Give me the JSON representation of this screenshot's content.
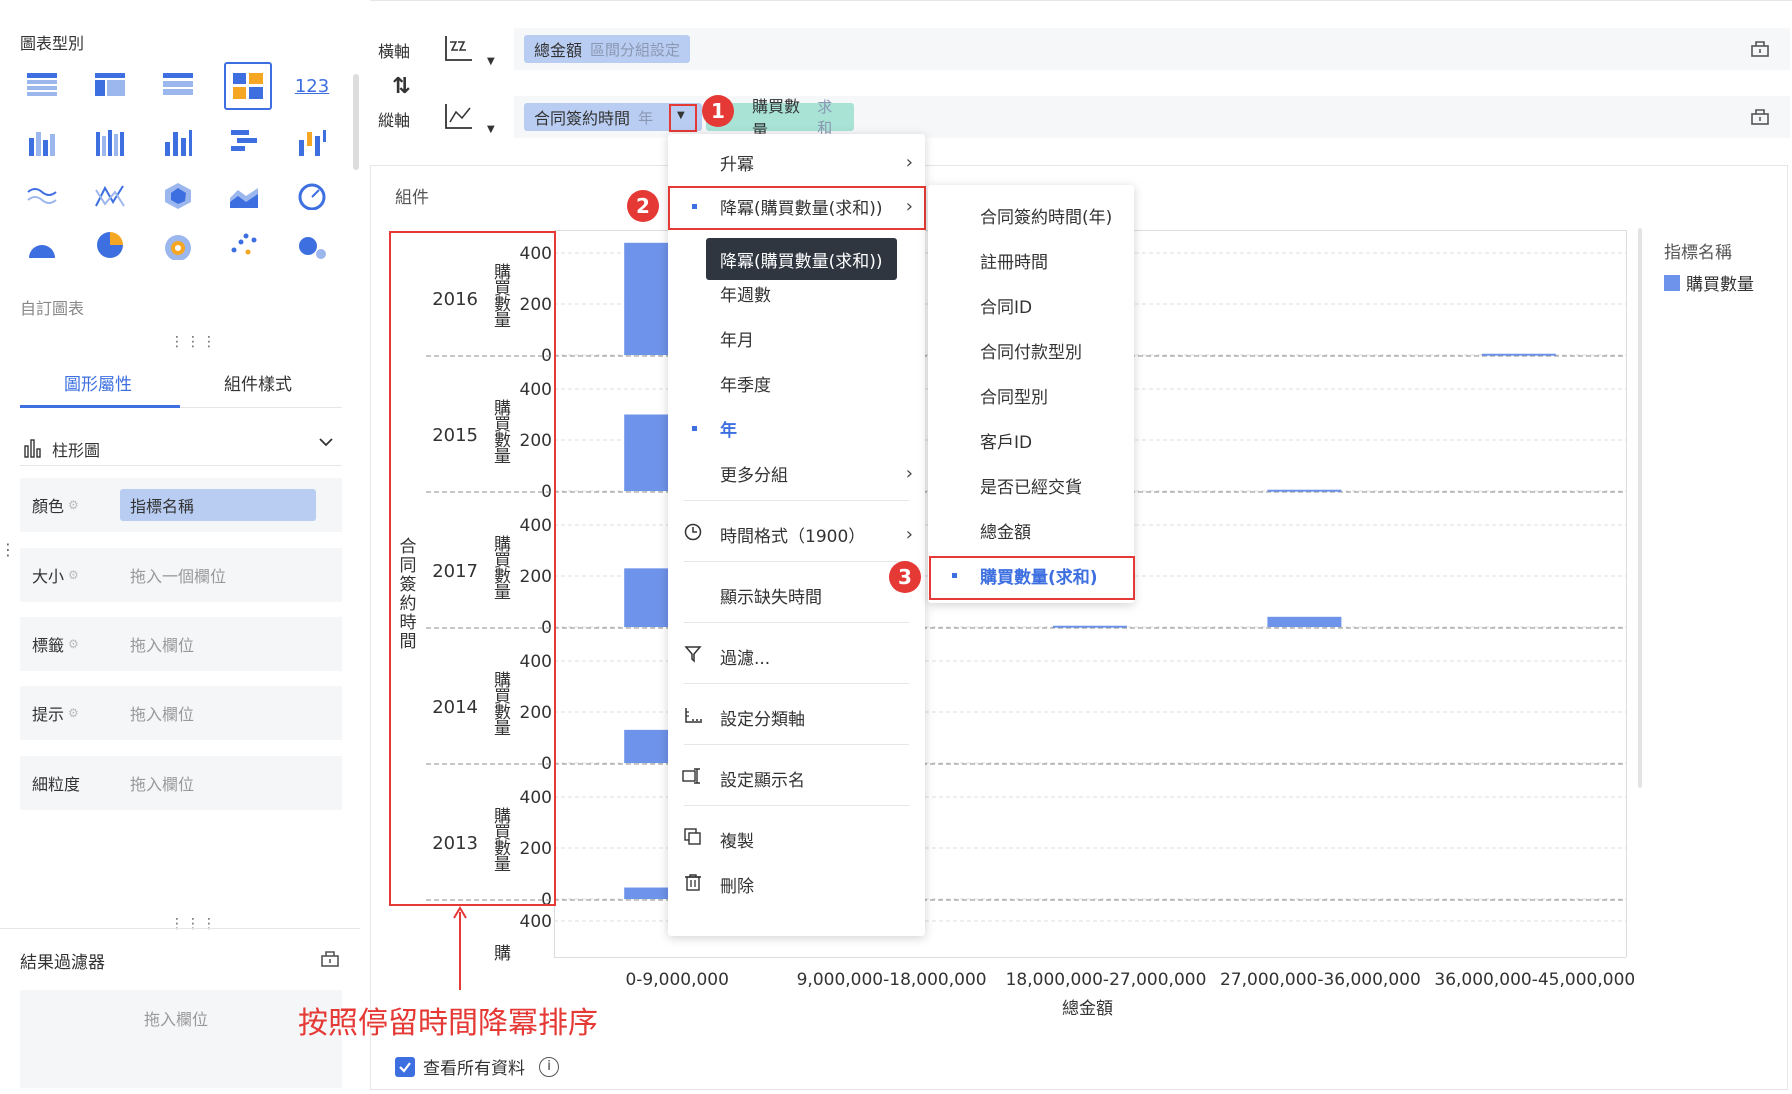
{
  "left_panel": {
    "chart_type_title": "圖表型別",
    "custom_chart_label": "自訂圖表",
    "icon_123": "123",
    "tabs": [
      "圖形屬性",
      "組件樣式"
    ],
    "chart_kind": "柱形圖",
    "props": [
      {
        "label": "顏色",
        "value": "指標名稱",
        "filled": true
      },
      {
        "label": "大小",
        "value": "拖入一個欄位",
        "filled": false
      },
      {
        "label": "標籤",
        "value": "拖入欄位",
        "filled": false
      },
      {
        "label": "提示",
        "value": "拖入欄位",
        "filled": false
      },
      {
        "label": "細粒度",
        "value": "拖入欄位",
        "filled": false
      }
    ],
    "result_filter": "結果過濾器",
    "result_filter_drop": "拖入欄位"
  },
  "shelves": {
    "x_label": "橫軸",
    "y_label": "縱軸",
    "swap_icon": "⇅",
    "x_field": "總金額",
    "x_field_sub": "區間分組設定",
    "y_field1": "合同簽約時間",
    "y_field1_sub": "年",
    "y_field2": "購買數量",
    "y_field2_sub": "求和"
  },
  "chart": {
    "component_label": "組件",
    "row_axis_title": "合同簽約時間",
    "measure_label": "購買數量",
    "legend_title": "指標名稱",
    "legend_item": "購買數量",
    "xlabel": "總金額",
    "view_all": "查看所有資料",
    "cut_label": "購"
  },
  "chart_data": {
    "type": "bar",
    "xlabel": "總金額",
    "categories": [
      "0-9,000,000",
      "9,000,000-18,000,000",
      "18,000,000-27,000,000",
      "27,000,000-36,000,000",
      "36,000,000-45,000,000"
    ],
    "yticks": [
      0,
      200,
      400
    ],
    "ylim": [
      0,
      400
    ],
    "rows": [
      {
        "year": "2016",
        "values": [
          480,
          null,
          null,
          null,
          5
        ]
      },
      {
        "year": "2015",
        "values": [
          300,
          null,
          null,
          5,
          null
        ]
      },
      {
        "year": "2017",
        "values": [
          230,
          null,
          5,
          40,
          null
        ]
      },
      {
        "year": "2014",
        "values": [
          130,
          null,
          null,
          null,
          null
        ]
      },
      {
        "year": "2013",
        "values": [
          45,
          null,
          null,
          null,
          null
        ]
      }
    ],
    "extra_row_tick": "400"
  },
  "menu": {
    "items": [
      "升冪",
      "降冪(購買數量(求和))",
      "年週數",
      "年月",
      "年季度",
      "年",
      "更多分組",
      "時間格式（1900）",
      "顯示缺失時間",
      "過濾...",
      "設定分類軸",
      "設定顯示名",
      "複製",
      "刪除"
    ],
    "tooltip": "降冪(購買數量(求和))"
  },
  "submenu": {
    "items": [
      "合同簽約時間(年)",
      "註冊時間",
      "合同ID",
      "合同付款型別",
      "合同型別",
      "客戶ID",
      "是否已經交貨",
      "總金額",
      "購買數量(求和)"
    ]
  },
  "annotations": {
    "badges": [
      "1",
      "2",
      "3"
    ],
    "note": "按照停留時間降冪排序"
  },
  "colors": {
    "accent": "#3d6fe0",
    "bar": "#6e93ea",
    "annotation": "#e53935"
  }
}
